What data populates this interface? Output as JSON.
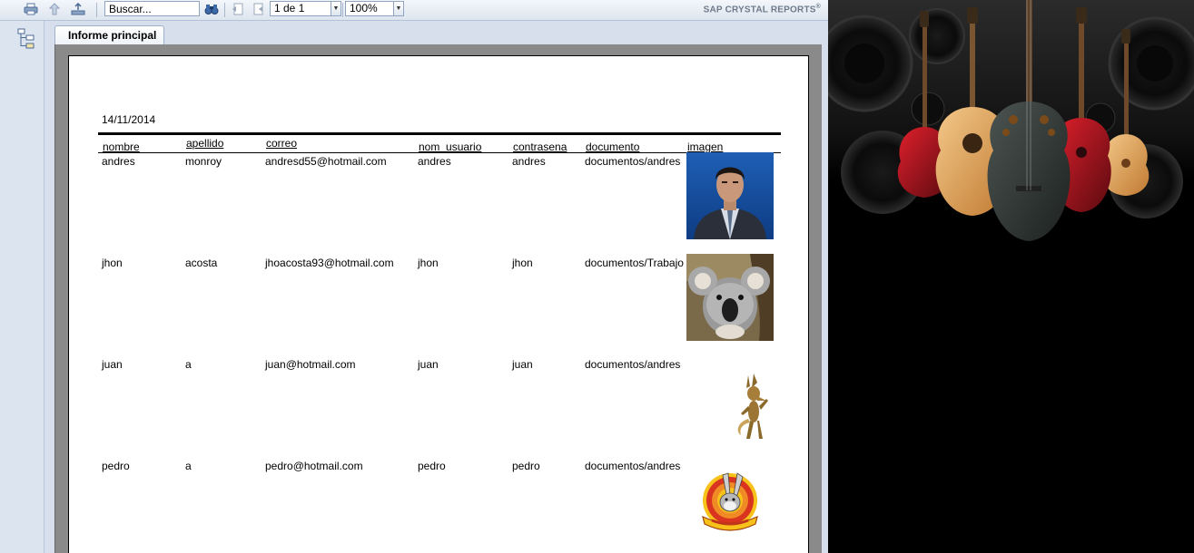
{
  "toolbar": {
    "search_placeholder": "Buscar...",
    "page_value": "1 de 1",
    "zoom_value": "100%",
    "brand": "SAP CRYSTAL REPORTS",
    "brand_mark": "®"
  },
  "tabs": [
    {
      "label": "Informe principal"
    }
  ],
  "report": {
    "date": "14/11/2014",
    "columns": [
      "nombre",
      "apellido",
      "correo",
      "nom_usuario",
      "contrasena",
      "documento",
      "imagen"
    ],
    "rows": [
      {
        "nombre": "andres",
        "apellido": "monroy",
        "correo": "andresd55@hotmail.com",
        "nom_usuario": "andres",
        "contrasena": "andres",
        "documento": "documentos/andres",
        "imagen": "portrait-photo"
      },
      {
        "nombre": "jhon",
        "apellido": "acosta",
        "correo": "jhoacosta93@hotmail.com",
        "nom_usuario": "jhon",
        "contrasena": "jhon",
        "documento": "documentos/Trabajo",
        "imagen": "koala-photo"
      },
      {
        "nombre": "juan",
        "apellido": "a",
        "correo": "juan@hotmail.com",
        "nom_usuario": "juan",
        "contrasena": "juan",
        "documento": "documentos/andres",
        "imagen": "coyote-cartoon"
      },
      {
        "nombre": "pedro",
        "apellido": "a",
        "correo": "pedro@hotmail.com",
        "nom_usuario": "pedro",
        "contrasena": "pedro",
        "documento": "documentos/andres",
        "imagen": "looney-tunes-logo"
      }
    ]
  },
  "icons": [
    "print-icon",
    "export-icon",
    "upload-icon",
    "binoculars-icon",
    "first-page-icon",
    "prev-page-icon",
    "group-tree-icon"
  ],
  "colors": {
    "toolbar_bg": "#dde5ef",
    "report_bg": "#8a8a8a",
    "tab_border": "#9fb1c8"
  }
}
